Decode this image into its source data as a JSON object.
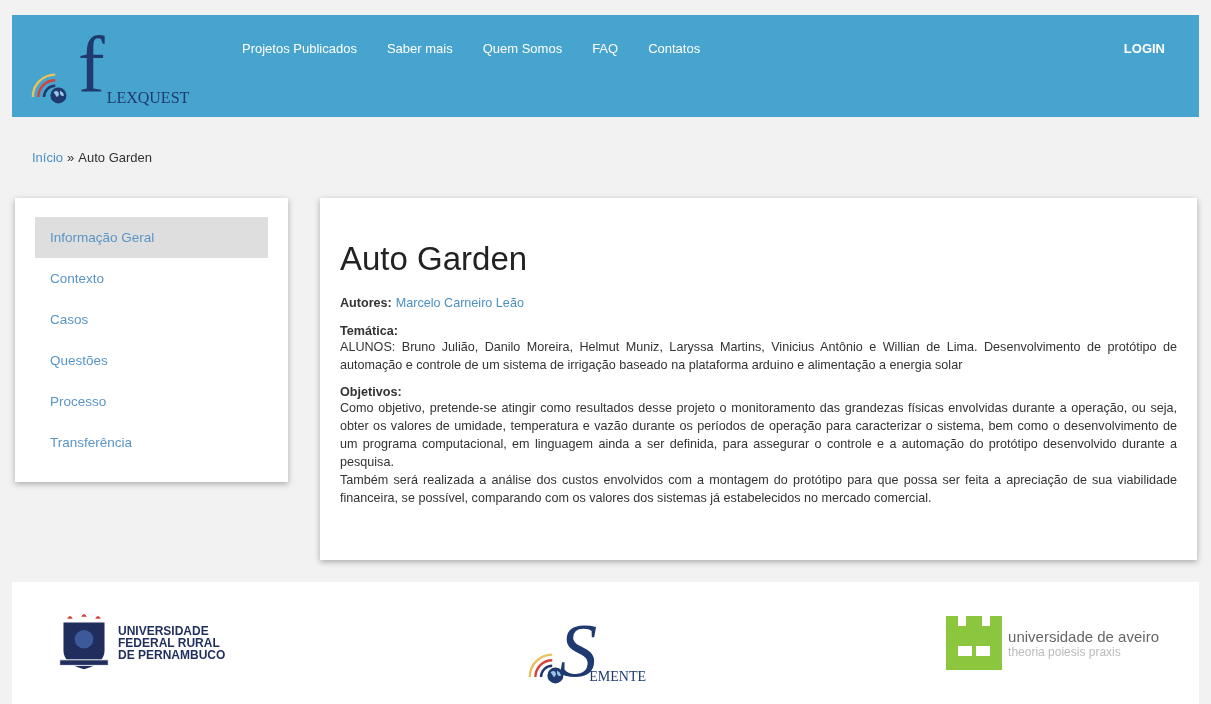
{
  "header": {
    "logo": {
      "initial": "f",
      "rest": "LEXQUEST"
    },
    "nav": [
      {
        "label": "Projetos Publicados"
      },
      {
        "label": "Saber mais"
      },
      {
        "label": "Quem Somos"
      },
      {
        "label": "FAQ"
      },
      {
        "label": "Contatos"
      }
    ],
    "login": "LOGIN"
  },
  "breadcrumb": {
    "link": "Início",
    "separator": "»",
    "current": "Auto Garden"
  },
  "sidebar": {
    "items": [
      {
        "label": "Informação Geral",
        "selected": true
      },
      {
        "label": "Contexto",
        "selected": false
      },
      {
        "label": "Casos",
        "selected": false
      },
      {
        "label": "Questões",
        "selected": false
      },
      {
        "label": "Processo",
        "selected": false
      },
      {
        "label": "Transferência",
        "selected": false
      }
    ]
  },
  "article": {
    "title": "Auto Garden",
    "authors_label": "Autores:",
    "author": "Marcelo Carneiro Leão",
    "sections": [
      {
        "heading": "Temática:",
        "paragraphs": [
          "ALUNOS: Bruno Julião, Danilo Moreira, Helmut Muniz, Laryssa Martins, Vinicius Antônio e Willian de Lima. Desenvolvimento de protótipo de automação e controle de um sistema de irrigação baseado na plataforma arduino e alimentação a energia solar"
        ]
      },
      {
        "heading": "Objetivos:",
        "paragraphs": [
          "Como objetivo, pretende-se atingir como resultados desse projeto o monitoramento das grandezas físicas envolvidas durante a operação, ou seja, obter os valores de umidade, temperatura e vazão durante os períodos de operação para caracterizar o sistema, bem como o desenvolvimento de um programa computacional, em linguagem ainda a ser definida, para assegurar o controle e a automação do protótipo desenvolvido durante a pesquisa.",
          "Também será realizada a análise dos custos envolvidos com a montagem do protótipo para que possa ser feita a apreciação de sua viabilidade financeira, se possível, comparando com os valores dos sistemas já estabelecidos no mercado comercial."
        ]
      }
    ]
  },
  "footer": {
    "ufrpe": [
      "UNIVERSIDADE",
      "FEDERAL RURAL",
      "DE PERNAMBUCO"
    ],
    "semente": {
      "initial": "S",
      "rest": "EMENTE"
    },
    "aveiro": {
      "name": "universidade de aveiro",
      "motto": "theoria poiesis praxis"
    }
  }
}
